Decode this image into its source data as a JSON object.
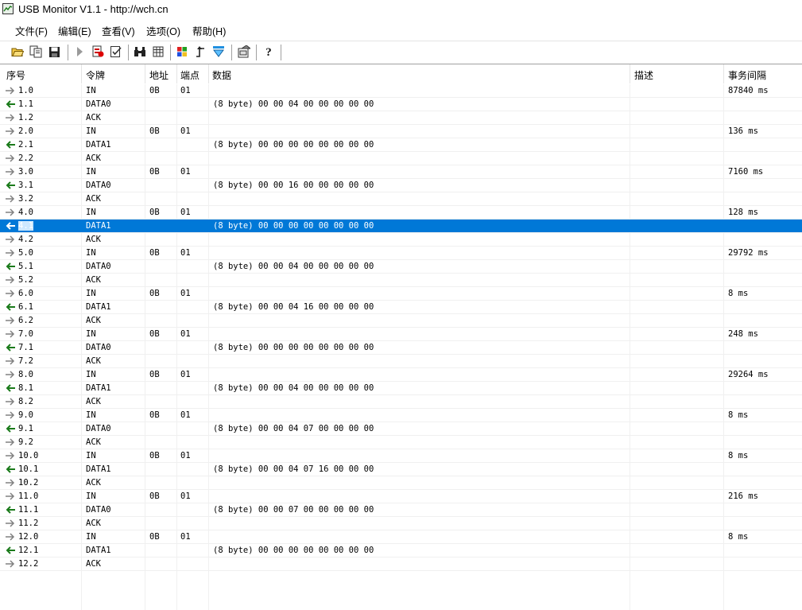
{
  "window": {
    "title": "USB Monitor V1.1 - http://wch.cn"
  },
  "menu": [
    {
      "label": "文件(F)"
    },
    {
      "label": "编辑(E)"
    },
    {
      "label": "查看(V)"
    },
    {
      "label": "选项(O)"
    },
    {
      "label": "帮助(H)"
    }
  ],
  "toolbar": [
    {
      "icon": "open-folder-icon"
    },
    {
      "icon": "copy-icon"
    },
    {
      "icon": "save-icon"
    },
    {
      "icon": "play-icon"
    },
    {
      "icon": "stop-record-icon"
    },
    {
      "icon": "checklist-icon"
    },
    {
      "icon": "binoculars-icon"
    },
    {
      "icon": "table-icon"
    },
    {
      "icon": "color-grid-icon"
    },
    {
      "icon": "step-icon"
    },
    {
      "icon": "filter-icon"
    },
    {
      "icon": "settings-icon"
    },
    {
      "icon": "help-icon"
    }
  ],
  "columns": {
    "seq": "序号",
    "token": "令牌",
    "addr": "地址",
    "endpoint": "端点",
    "data": "数据",
    "desc": "描述",
    "interval": "事务间隔"
  },
  "rows": [
    {
      "dir": "out",
      "seq": "1.0",
      "token": "IN",
      "addr": "0B",
      "ep": "01",
      "data": "",
      "interval": "87840 ms"
    },
    {
      "dir": "in",
      "seq": "1.1",
      "token": "DATA0",
      "addr": "",
      "ep": "",
      "data": "(8 byte) 00 00 04 00 00 00 00 00",
      "interval": ""
    },
    {
      "dir": "out",
      "seq": "1.2",
      "token": "ACK",
      "addr": "",
      "ep": "",
      "data": "",
      "interval": ""
    },
    {
      "dir": "out",
      "seq": "2.0",
      "token": "IN",
      "addr": "0B",
      "ep": "01",
      "data": "",
      "interval": "136 ms"
    },
    {
      "dir": "in",
      "seq": "2.1",
      "token": "DATA1",
      "addr": "",
      "ep": "",
      "data": "(8 byte) 00 00 00 00 00 00 00 00",
      "interval": ""
    },
    {
      "dir": "out",
      "seq": "2.2",
      "token": "ACK",
      "addr": "",
      "ep": "",
      "data": "",
      "interval": ""
    },
    {
      "dir": "out",
      "seq": "3.0",
      "token": "IN",
      "addr": "0B",
      "ep": "01",
      "data": "",
      "interval": "7160 ms"
    },
    {
      "dir": "in",
      "seq": "3.1",
      "token": "DATA0",
      "addr": "",
      "ep": "",
      "data": "(8 byte) 00 00 16 00 00 00 00 00",
      "interval": ""
    },
    {
      "dir": "out",
      "seq": "3.2",
      "token": "ACK",
      "addr": "",
      "ep": "",
      "data": "",
      "interval": ""
    },
    {
      "dir": "out",
      "seq": "4.0",
      "token": "IN",
      "addr": "0B",
      "ep": "01",
      "data": "",
      "interval": "128 ms"
    },
    {
      "dir": "in",
      "seq": "4.1",
      "token": "DATA1",
      "addr": "",
      "ep": "",
      "data": "(8 byte) 00 00 00 00 00 00 00 00",
      "interval": "",
      "selected": true
    },
    {
      "dir": "out",
      "seq": "4.2",
      "token": "ACK",
      "addr": "",
      "ep": "",
      "data": "",
      "interval": ""
    },
    {
      "dir": "out",
      "seq": "5.0",
      "token": "IN",
      "addr": "0B",
      "ep": "01",
      "data": "",
      "interval": "29792 ms"
    },
    {
      "dir": "in",
      "seq": "5.1",
      "token": "DATA0",
      "addr": "",
      "ep": "",
      "data": "(8 byte) 00 00 04 00 00 00 00 00",
      "interval": ""
    },
    {
      "dir": "out",
      "seq": "5.2",
      "token": "ACK",
      "addr": "",
      "ep": "",
      "data": "",
      "interval": ""
    },
    {
      "dir": "out",
      "seq": "6.0",
      "token": "IN",
      "addr": "0B",
      "ep": "01",
      "data": "",
      "interval": "8 ms"
    },
    {
      "dir": "in",
      "seq": "6.1",
      "token": "DATA1",
      "addr": "",
      "ep": "",
      "data": "(8 byte) 00 00 04 16 00 00 00 00",
      "interval": ""
    },
    {
      "dir": "out",
      "seq": "6.2",
      "token": "ACK",
      "addr": "",
      "ep": "",
      "data": "",
      "interval": ""
    },
    {
      "dir": "out",
      "seq": "7.0",
      "token": "IN",
      "addr": "0B",
      "ep": "01",
      "data": "",
      "interval": "248 ms"
    },
    {
      "dir": "in",
      "seq": "7.1",
      "token": "DATA0",
      "addr": "",
      "ep": "",
      "data": "(8 byte) 00 00 00 00 00 00 00 00",
      "interval": ""
    },
    {
      "dir": "out",
      "seq": "7.2",
      "token": "ACK",
      "addr": "",
      "ep": "",
      "data": "",
      "interval": ""
    },
    {
      "dir": "out",
      "seq": "8.0",
      "token": "IN",
      "addr": "0B",
      "ep": "01",
      "data": "",
      "interval": "29264 ms"
    },
    {
      "dir": "in",
      "seq": "8.1",
      "token": "DATA1",
      "addr": "",
      "ep": "",
      "data": "(8 byte) 00 00 04 00 00 00 00 00",
      "interval": ""
    },
    {
      "dir": "out",
      "seq": "8.2",
      "token": "ACK",
      "addr": "",
      "ep": "",
      "data": "",
      "interval": ""
    },
    {
      "dir": "out",
      "seq": "9.0",
      "token": "IN",
      "addr": "0B",
      "ep": "01",
      "data": "",
      "interval": "8 ms"
    },
    {
      "dir": "in",
      "seq": "9.1",
      "token": "DATA0",
      "addr": "",
      "ep": "",
      "data": "(8 byte) 00 00 04 07 00 00 00 00",
      "interval": ""
    },
    {
      "dir": "out",
      "seq": "9.2",
      "token": "ACK",
      "addr": "",
      "ep": "",
      "data": "",
      "interval": ""
    },
    {
      "dir": "out",
      "seq": "10.0",
      "token": "IN",
      "addr": "0B",
      "ep": "01",
      "data": "",
      "interval": "8 ms"
    },
    {
      "dir": "in",
      "seq": "10.1",
      "token": "DATA1",
      "addr": "",
      "ep": "",
      "data": "(8 byte) 00 00 04 07 16 00 00 00",
      "interval": ""
    },
    {
      "dir": "out",
      "seq": "10.2",
      "token": "ACK",
      "addr": "",
      "ep": "",
      "data": "",
      "interval": ""
    },
    {
      "dir": "out",
      "seq": "11.0",
      "token": "IN",
      "addr": "0B",
      "ep": "01",
      "data": "",
      "interval": "216 ms"
    },
    {
      "dir": "in",
      "seq": "11.1",
      "token": "DATA0",
      "addr": "",
      "ep": "",
      "data": "(8 byte) 00 00 07 00 00 00 00 00",
      "interval": ""
    },
    {
      "dir": "out",
      "seq": "11.2",
      "token": "ACK",
      "addr": "",
      "ep": "",
      "data": "",
      "interval": ""
    },
    {
      "dir": "out",
      "seq": "12.0",
      "token": "IN",
      "addr": "0B",
      "ep": "01",
      "data": "",
      "interval": "8 ms"
    },
    {
      "dir": "in",
      "seq": "12.1",
      "token": "DATA1",
      "addr": "",
      "ep": "",
      "data": "(8 byte) 00 00 00 00 00 00 00 00",
      "interval": ""
    },
    {
      "dir": "out",
      "seq": "12.2",
      "token": "ACK",
      "addr": "",
      "ep": "",
      "data": "",
      "interval": ""
    }
  ],
  "colors": {
    "selection": "#0078d7",
    "in_arrow": "#1a7a1a",
    "out_arrow": "#808080"
  }
}
